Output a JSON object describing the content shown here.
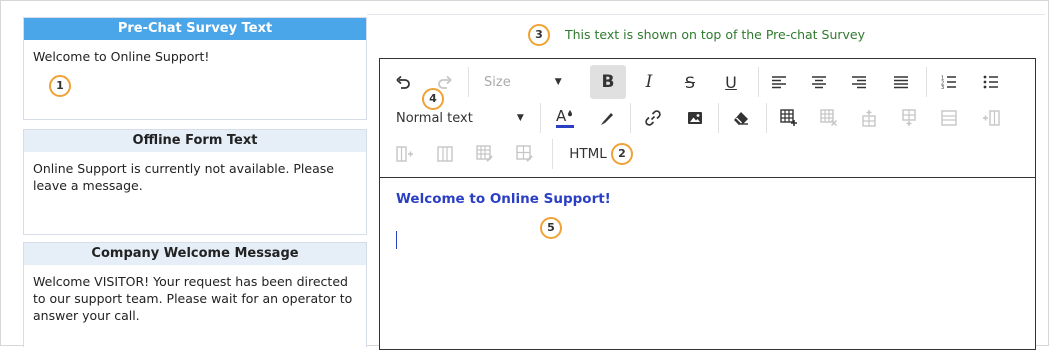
{
  "panels": [
    {
      "title": "Pre-Chat Survey Text",
      "body": "Welcome to Online Support!"
    },
    {
      "title": "Offline Form Text",
      "body": "Online Support is currently not available. Please leave a message."
    },
    {
      "title": "Company Welcome Message",
      "body": "Welcome VISITOR! Your request has been directed to our support team. Please wait for an operator to answer your call."
    }
  ],
  "hint": "This text is shown on top of the Pre-chat Survey",
  "badges": {
    "b1": "1",
    "b2": "2",
    "b3": "3",
    "b4": "4",
    "b5": "5"
  },
  "toolbar": {
    "size_label": "Size",
    "block_label": "Normal text",
    "bold": "B",
    "italic": "I",
    "strike": "S",
    "underline": "U",
    "html_label": "HTML"
  },
  "editor": {
    "content": "Welcome to Online Support!"
  },
  "colors": {
    "accent": "#4aa6e8",
    "panel_header": "#e6eef8",
    "hint": "#2e7a2e",
    "content": "#2b3fc4",
    "badge": "#f0a236"
  }
}
